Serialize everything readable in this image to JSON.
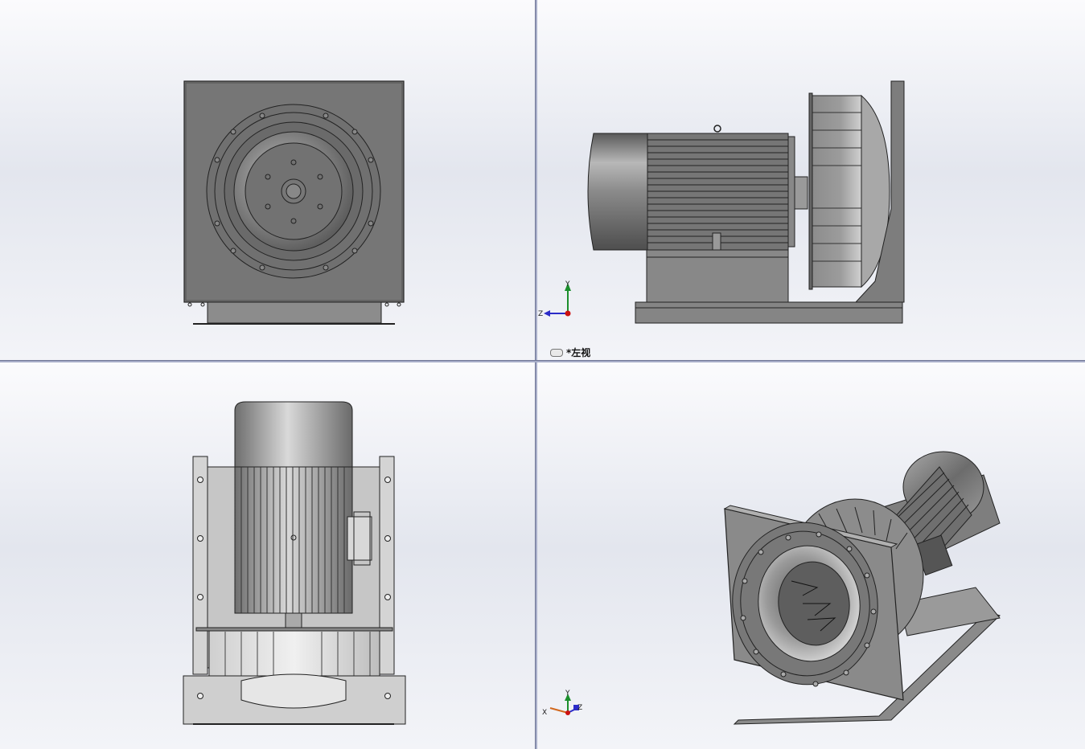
{
  "viewports": {
    "front": {
      "name": "front-view"
    },
    "left": {
      "name": "left-view",
      "label": "*左视"
    },
    "top": {
      "name": "top-view"
    },
    "iso": {
      "name": "isometric-view"
    }
  },
  "triad_left": {
    "y": "Y",
    "z": "Z"
  },
  "triad_iso": {
    "x": "X",
    "y": "Y",
    "z": "Z"
  },
  "colors": {
    "background_top": "#fbfbfd",
    "background_mid": "#e3e6ee",
    "split_bar": "#a7adc8",
    "model_gray": "#7b7b7b",
    "axis_y": "#1c8f2c",
    "axis_z": "#2b2bc8",
    "axis_x": "#d2691e",
    "origin": "#cc1111"
  },
  "icons": [
    "link-icon",
    "axis-triad-icon"
  ]
}
